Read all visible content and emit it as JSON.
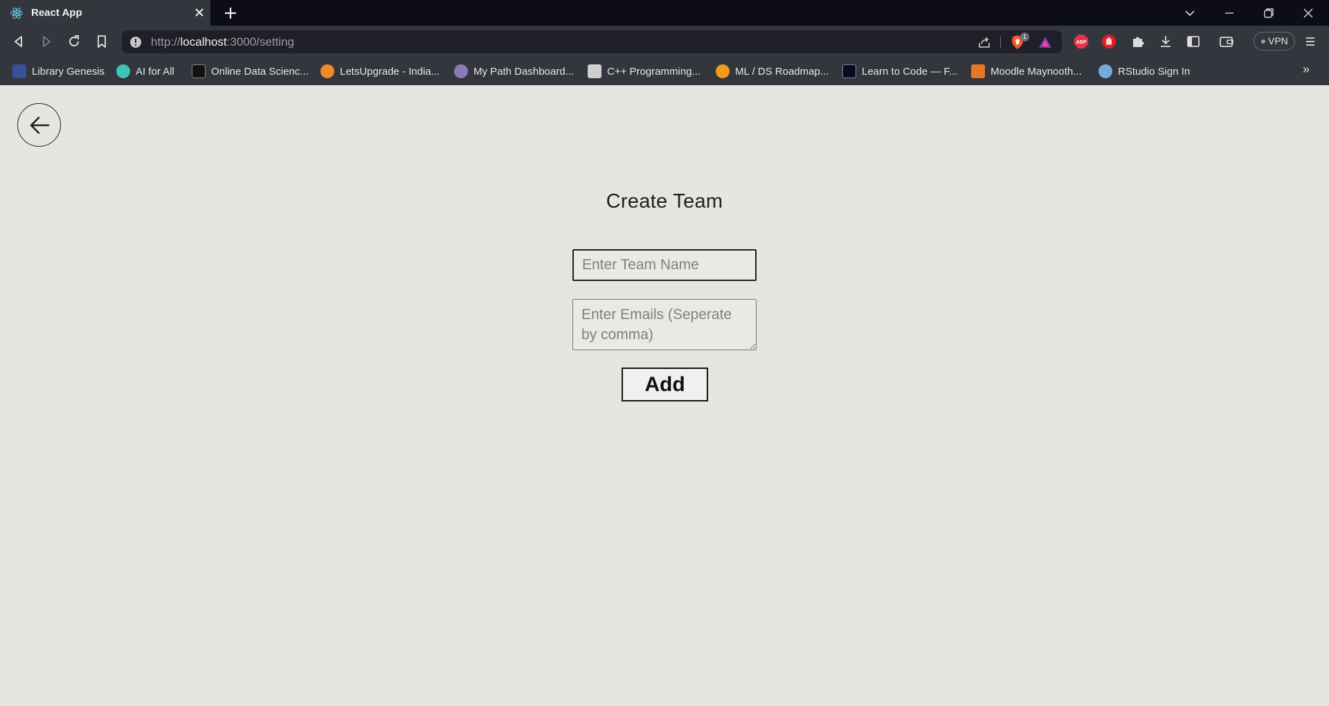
{
  "browser": {
    "tab": {
      "title": "React App",
      "icon": "react-icon"
    },
    "url": {
      "scheme": "http://",
      "host": "localhost",
      "rest": ":3000/setting"
    },
    "shields_count": "1",
    "vpn_label": "VPN",
    "bookmarks": [
      {
        "label": "Library Genesis",
        "icon": "library-genesis-icon",
        "color": "#3a4f9a"
      },
      {
        "label": "AI for All",
        "icon": "ai-for-all-icon",
        "color": "#3bc6b6"
      },
      {
        "label": "Online Data Scienc...",
        "icon": "data-science-icon",
        "color": "#111111"
      },
      {
        "label": "LetsUpgrade - India...",
        "icon": "letsupgrade-icon",
        "color": "#f08a24"
      },
      {
        "label": "My Path Dashboard...",
        "icon": "my-path-icon",
        "color": "#8a7bb8"
      },
      {
        "label": "C++ Programming...",
        "icon": "cpp-programming-icon",
        "color": "#cfcfcf"
      },
      {
        "label": "ML / DS Roadmap...",
        "icon": "roadmap-icon",
        "color": "#f29a1b"
      },
      {
        "label": "Learn to Code — F...",
        "icon": "freecodecamp-icon",
        "color": "#0a0a23"
      },
      {
        "label": "Moodle Maynooth...",
        "icon": "moodle-icon",
        "color": "#e87722"
      },
      {
        "label": "RStudio Sign In",
        "icon": "rstudio-icon",
        "color": "#75aadb"
      }
    ],
    "bookmarks_more": "»"
  },
  "page": {
    "title": "Create Team",
    "team_name_placeholder": "Enter Team Name",
    "emails_placeholder": "Enter Emails (Seperate by comma)",
    "add_label": "Add"
  }
}
